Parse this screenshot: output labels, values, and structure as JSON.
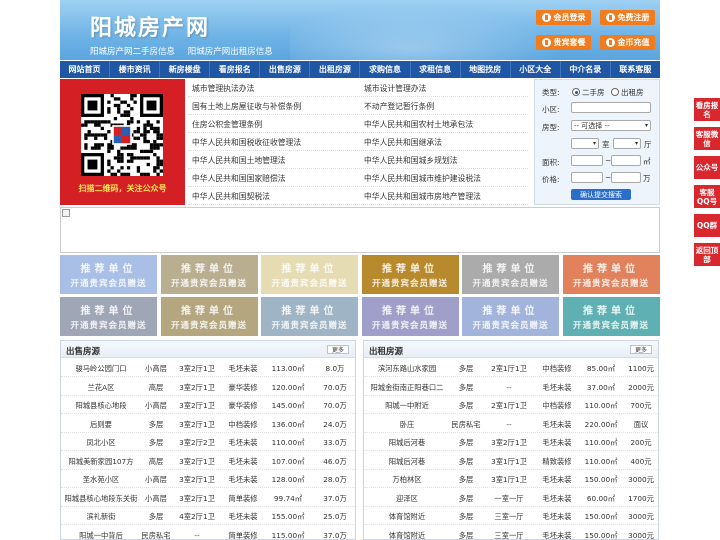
{
  "header": {
    "title": "阳城房产网",
    "subtitle_1": "阳城房产网二手房信息",
    "subtitle_2": "阳城房产网出租房信息",
    "buttons": [
      "会员登录",
      "免费注册",
      "贵宾套餐",
      "金币充值"
    ]
  },
  "nav": [
    "网站首页",
    "楼市资讯",
    "新房楼盘",
    "看房报名",
    "出售房源",
    "出租房源",
    "求购信息",
    "求租信息",
    "地图找房",
    "小区大全",
    "中介名录",
    "联系客服"
  ],
  "qr": {
    "caption": "扫描二维码，关注公众号"
  },
  "laws": {
    "left": [
      "城市管理执法办法",
      "国有土地上房屋征收与补偿条例",
      "住房公积金管理条例",
      "中华人民共和国税收征收管理法",
      "中华人民共和国土地管理法",
      "中华人民共和国国家赔偿法",
      "中华人民共和国契税法"
    ],
    "right": [
      "城市设计管理办法",
      "不动产登记暂行条例",
      "中华人民共和国农村土地承包法",
      "中华人民共和国继承法",
      "中华人民共和国城乡规划法",
      "中华人民共和国城市维护建设税法",
      "中华人民共和国城市房地产管理法"
    ]
  },
  "search": {
    "type_label": "类型:",
    "opt_sale": "二手房",
    "opt_rent": "出租房",
    "community_label": "小区:",
    "room_label": "房型:",
    "room_select": "-- 可选择 --",
    "unit_room": "室",
    "unit_hall": "厅",
    "area_label": "面积:",
    "area_unit": "㎡",
    "price_label": "价格:",
    "price_unit": "万",
    "dash": "~",
    "submit": "确认提交搜索"
  },
  "promo": {
    "line1": "推荐单位",
    "line2": "开通贵宾会员赠送"
  },
  "promo_colors": [
    "#a9bfe6",
    "#b9ae90",
    "#e6dcb4",
    "#b88a2e",
    "#ababab",
    "#e2825c",
    "#9fa7b6",
    "#b4a77f",
    "#9fb4c4",
    "#9f9fc9",
    "#a3b4dc",
    "#5fb0b2"
  ],
  "sale": {
    "title": "出售房源",
    "more": "更多",
    "rows": [
      [
        "骏马岭公园门口",
        "小高层",
        "3室2厅1卫",
        "毛坯未装",
        "113.00㎡",
        "8.0万"
      ],
      [
        "兰花A区",
        "高层",
        "3室2厅1卫",
        "豪华装修",
        "120.00㎡",
        "70.0万"
      ],
      [
        "阳城县核心地段",
        "小高层",
        "3室2厅1卫",
        "豪华装修",
        "145.00㎡",
        "70.0万"
      ],
      [
        "后则要",
        "多层",
        "3室2厅1卫",
        "中档装修",
        "136.00㎡",
        "24.0万"
      ],
      [
        "凤北小区",
        "多层",
        "3室2厅2卫",
        "毛坯未装",
        "110.00㎡",
        "33.0万"
      ],
      [
        "阳城美新家园107方",
        "高层",
        "3室2厅1卫",
        "毛坯未装",
        "107.00㎡",
        "46.0万"
      ],
      [
        "圣水苑小区",
        "小高层",
        "3室2厅1卫",
        "毛坯未装",
        "128.00㎡",
        "28.0万"
      ],
      [
        "阳城县核心地段东关街",
        "小高层",
        "3室2厅1卫",
        "简单装修",
        "99.74㎡",
        "37.0万"
      ],
      [
        "滨礼新街",
        "多层",
        "4室2厅1卫",
        "毛坯未装",
        "155.00㎡",
        "25.0万"
      ],
      [
        "阳城一中背后",
        "民房私宅",
        "--",
        "简单装修",
        "115.00㎡",
        "37.0万"
      ]
    ]
  },
  "rent": {
    "title": "出租房源",
    "more": "更多",
    "rows": [
      [
        "滨河东路山水家园",
        "多层",
        "2室1厅1卫",
        "中档装修",
        "85.00㎡",
        "1100元"
      ],
      [
        "阳城金街南正阳巷口二",
        "多层",
        "--",
        "毛坯未装",
        "37.00㎡",
        "2000元"
      ],
      [
        "阳城一中附近",
        "多层",
        "2室1厅1卫",
        "中档装修",
        "110.00㎡",
        "700元"
      ],
      [
        "卧庄",
        "民房私宅",
        "--",
        "毛坯未装",
        "220.00㎡",
        "面议"
      ],
      [
        "阳城后河巷",
        "多层",
        "3室2厅1卫",
        "毛坯未装",
        "110.00㎡",
        "200元"
      ],
      [
        "阳城后河巷",
        "多层",
        "3室1厅1卫",
        "精致装修",
        "110.00㎡",
        "400元"
      ],
      [
        "万柏林区",
        "多层",
        "3室1厅1卫",
        "毛坯未装",
        "150.00㎡",
        "3000元"
      ],
      [
        "迎泽区",
        "多层",
        "一室一厅",
        "毛坯未装",
        "60.00㎡",
        "1700元"
      ],
      [
        "体育馆附近",
        "多层",
        "三室一厅",
        "毛坯未装",
        "150.00㎡",
        "3000元"
      ],
      [
        "体育馆附近",
        "多层",
        "三室一厅",
        "毛坯未装",
        "150.00㎡",
        "3000元"
      ]
    ]
  },
  "side": [
    "看房报名",
    "客服微信",
    "公众号",
    "客服QQ号",
    "QQ群",
    "返回顶部"
  ]
}
